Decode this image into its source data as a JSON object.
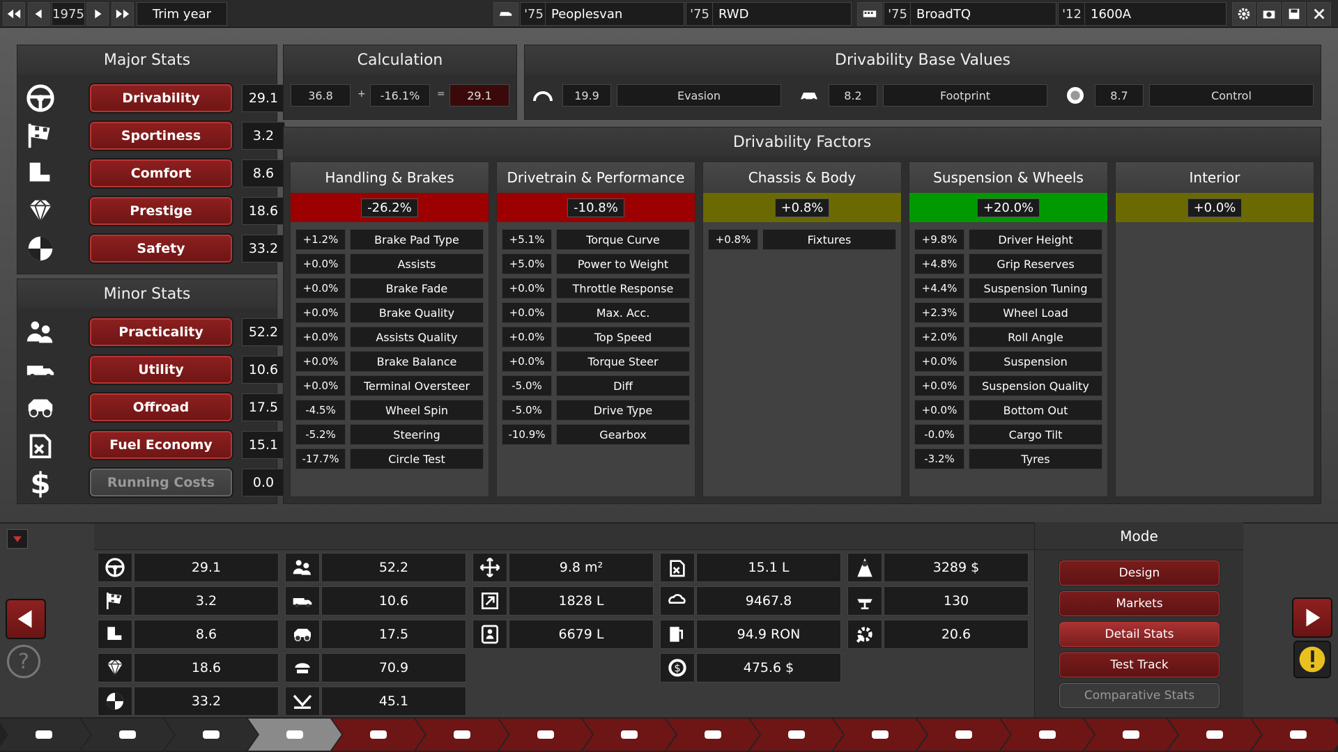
{
  "topbar": {
    "year": "1975",
    "trim": "Trim year",
    "model_year": "'75",
    "model": "Peoplesvan",
    "drive_year": "'75",
    "drive": "RWD",
    "engine_year": "'75",
    "engine": "BroadTQ",
    "variant_year": "'12",
    "variant": "1600A"
  },
  "major": {
    "title": "Major Stats",
    "items": [
      {
        "label": "Drivability",
        "value": "29.1",
        "icon": "steering-wheel-icon"
      },
      {
        "label": "Sportiness",
        "value": "3.2",
        "icon": "checkered-flag-icon"
      },
      {
        "label": "Comfort",
        "value": "8.6",
        "icon": "seat-icon"
      },
      {
        "label": "Prestige",
        "value": "18.6",
        "icon": "diamond-icon"
      },
      {
        "label": "Safety",
        "value": "33.2",
        "icon": "crash-test-icon"
      }
    ]
  },
  "minor": {
    "title": "Minor Stats",
    "items": [
      {
        "label": "Practicality",
        "value": "52.2",
        "icon": "people-icon"
      },
      {
        "label": "Utility",
        "value": "10.6",
        "icon": "truck-icon"
      },
      {
        "label": "Offroad",
        "value": "17.5",
        "icon": "offroad-icon"
      },
      {
        "label": "Fuel Economy",
        "value": "15.1",
        "icon": "fuel-can-icon"
      },
      {
        "label": "Running Costs",
        "value": "0.0",
        "icon": "dollar-icon"
      }
    ]
  },
  "calc": {
    "title": "Calculation",
    "a": "36.8",
    "op1": "+",
    "b": "-16.1%",
    "op2": "=",
    "result": "29.1"
  },
  "base": {
    "title": "Drivability Base Values",
    "evasion_value": "19.9",
    "evasion_label": "Evasion",
    "footprint_value": "8.2",
    "footprint_label": "Footprint",
    "control_value": "8.7",
    "control_label": "Control"
  },
  "factors": {
    "title": "Drivability Factors",
    "columns": [
      {
        "title": "Handling & Brakes",
        "total": "-26.2%",
        "color": "#9c0000",
        "rows": [
          [
            "+1.2%",
            "Brake Pad Type"
          ],
          [
            "+0.0%",
            "Assists"
          ],
          [
            "+0.0%",
            "Brake Fade"
          ],
          [
            "+0.0%",
            "Brake Quality"
          ],
          [
            "+0.0%",
            "Assists Quality"
          ],
          [
            "+0.0%",
            "Brake Balance"
          ],
          [
            "+0.0%",
            "Terminal Oversteer"
          ],
          [
            "-4.5%",
            "Wheel Spin"
          ],
          [
            "-5.2%",
            "Steering"
          ],
          [
            "-17.7%",
            "Circle Test"
          ]
        ]
      },
      {
        "title": "Drivetrain & Performance",
        "total": "-10.8%",
        "color": "#9c0000",
        "rows": [
          [
            "+5.1%",
            "Torque Curve"
          ],
          [
            "+5.0%",
            "Power to Weight"
          ],
          [
            "+0.0%",
            "Throttle Response"
          ],
          [
            "+0.0%",
            "Max. Acc."
          ],
          [
            "+0.0%",
            "Top Speed"
          ],
          [
            "+0.0%",
            "Torque Steer"
          ],
          [
            "-5.0%",
            "Diff"
          ],
          [
            "-5.0%",
            "Drive Type"
          ],
          [
            "-10.9%",
            "Gearbox"
          ]
        ]
      },
      {
        "title": "Chassis & Body",
        "total": "+0.8%",
        "color": "#6a6a00",
        "rows": [
          [
            "+0.8%",
            "Fixtures"
          ]
        ]
      },
      {
        "title": "Suspension & Wheels",
        "total": "+20.0%",
        "color": "#009a00",
        "rows": [
          [
            "+9.8%",
            "Driver Height"
          ],
          [
            "+4.8%",
            "Grip Reserves"
          ],
          [
            "+4.4%",
            "Suspension Tuning"
          ],
          [
            "+2.3%",
            "Wheel Load"
          ],
          [
            "+2.0%",
            "Roll Angle"
          ],
          [
            "+0.0%",
            "Suspension"
          ],
          [
            "+0.0%",
            "Suspension Quality"
          ],
          [
            "+0.0%",
            "Bottom Out"
          ],
          [
            "-0.0%",
            "Cargo Tilt"
          ],
          [
            "-3.2%",
            "Tyres"
          ]
        ]
      },
      {
        "title": "Interior",
        "total": "+0.0%",
        "color": "#6a6a00",
        "rows": []
      }
    ]
  },
  "summary": {
    "col1": [
      "29.1",
      "3.2",
      "8.6",
      "18.6",
      "33.2"
    ],
    "col2": [
      "52.2",
      "10.6",
      "17.5",
      "70.9",
      "45.1"
    ],
    "col3": [
      "9.8 m²",
      "1828 L",
      "6679 L"
    ],
    "col4": [
      "15.1 L",
      "9467.8",
      "94.9 RON",
      "475.6 $"
    ],
    "col5": [
      "3289 $",
      "130",
      "20.6"
    ]
  },
  "mode": {
    "title": "Mode",
    "buttons": [
      "Design",
      "Markets",
      "Detail Stats",
      "Test Track",
      "Comparative Stats"
    ]
  },
  "colors": {
    "accent": "#8e2020",
    "panel": "#2e2e2e"
  }
}
